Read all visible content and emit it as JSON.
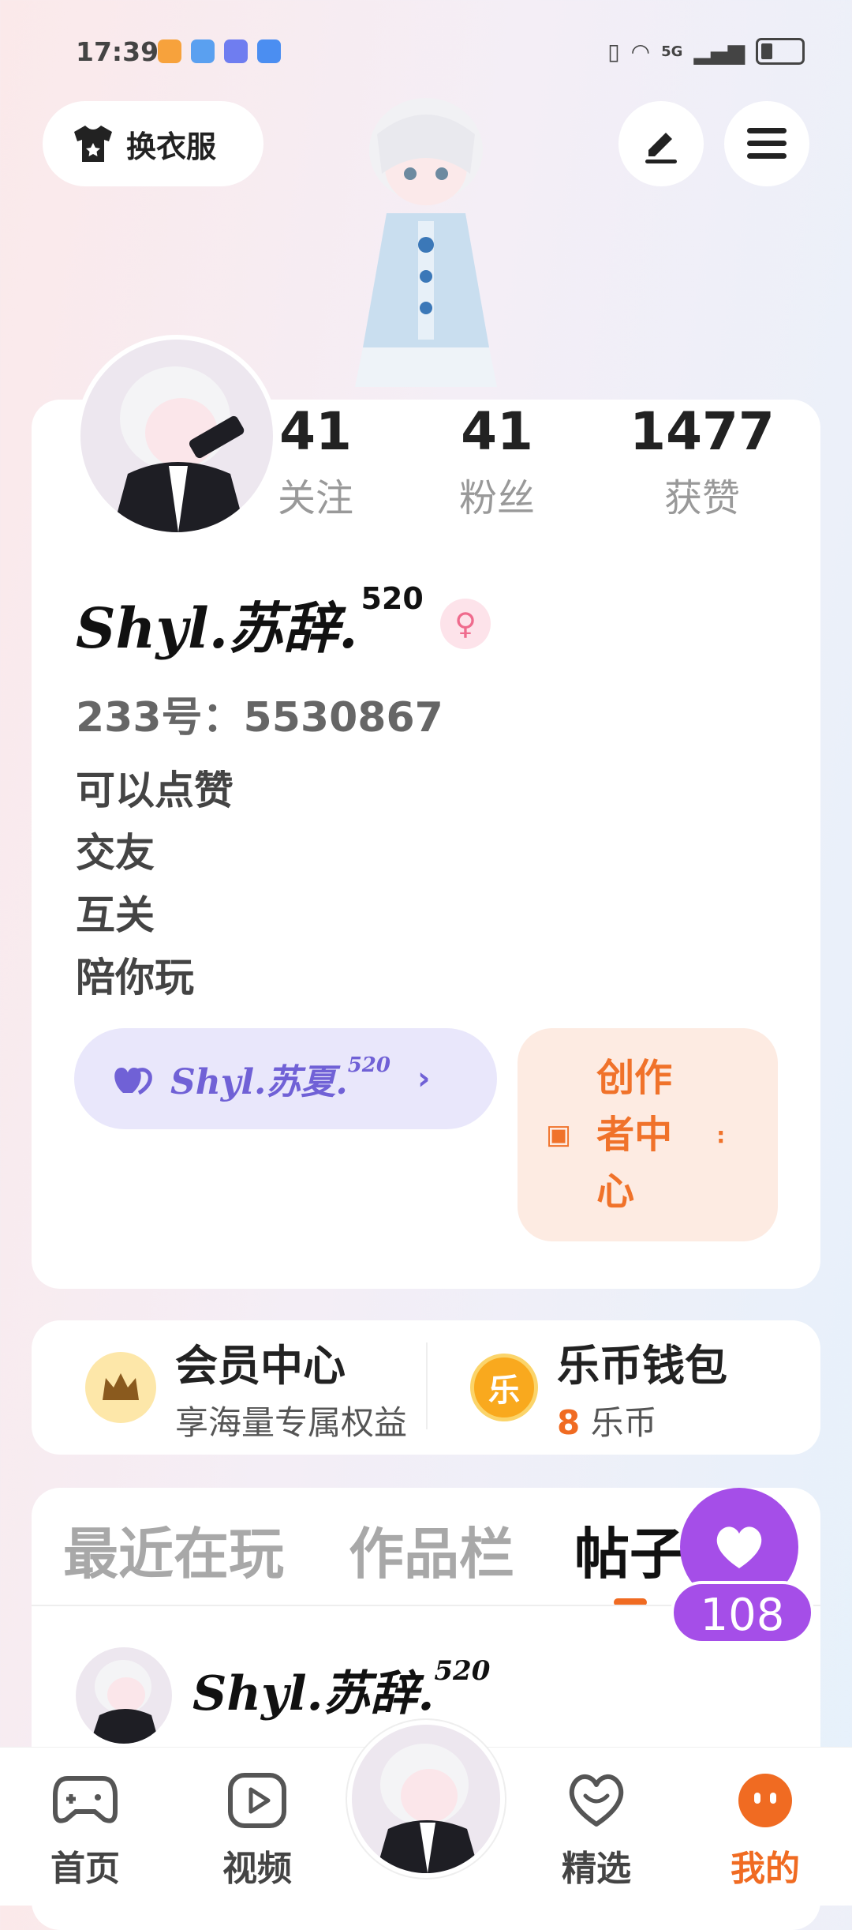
{
  "status_bar": {
    "time": "17:39",
    "network": "5G"
  },
  "header": {
    "outfit_label": "换衣服"
  },
  "stats": [
    {
      "value": "41",
      "label": "关注"
    },
    {
      "value": "41",
      "label": "粉丝"
    },
    {
      "value": "1477",
      "label": "获赞"
    }
  ],
  "profile": {
    "name": "Shyl.苏辞.",
    "name_sup": "520",
    "gender_symbol": "♀",
    "id_text": "233号：5530867",
    "bio": [
      "可以点赞",
      "交友",
      "互关",
      "陪你玩"
    ]
  },
  "partner": {
    "name": "Shyl.苏夏.",
    "name_sup": "520"
  },
  "creator": {
    "label_lines": [
      "创作",
      "者中",
      "心"
    ]
  },
  "member": {
    "title": "会员中心",
    "subtitle": "享海量专属权益"
  },
  "wallet": {
    "title": "乐币钱包",
    "amount": "8",
    "unit": "乐币",
    "coin_char": "乐"
  },
  "tabs": [
    {
      "label": "最近在玩",
      "active": false
    },
    {
      "label": "作品栏",
      "active": false
    },
    {
      "label": "帖子",
      "active": true
    }
  ],
  "likes": {
    "count": "108"
  },
  "post": {
    "author": "Shyl.苏辞.",
    "author_sup": "520"
  },
  "nav": [
    {
      "label": "首页",
      "icon": "gamepad-icon"
    },
    {
      "label": "视频",
      "icon": "video-icon"
    },
    {
      "label": "精选",
      "icon": "heart-badge-icon"
    },
    {
      "label": "我的",
      "icon": "face-icon"
    }
  ],
  "colors": {
    "accent": "#f06b22",
    "purple": "#a54ee8",
    "partner": "#7061d6"
  }
}
